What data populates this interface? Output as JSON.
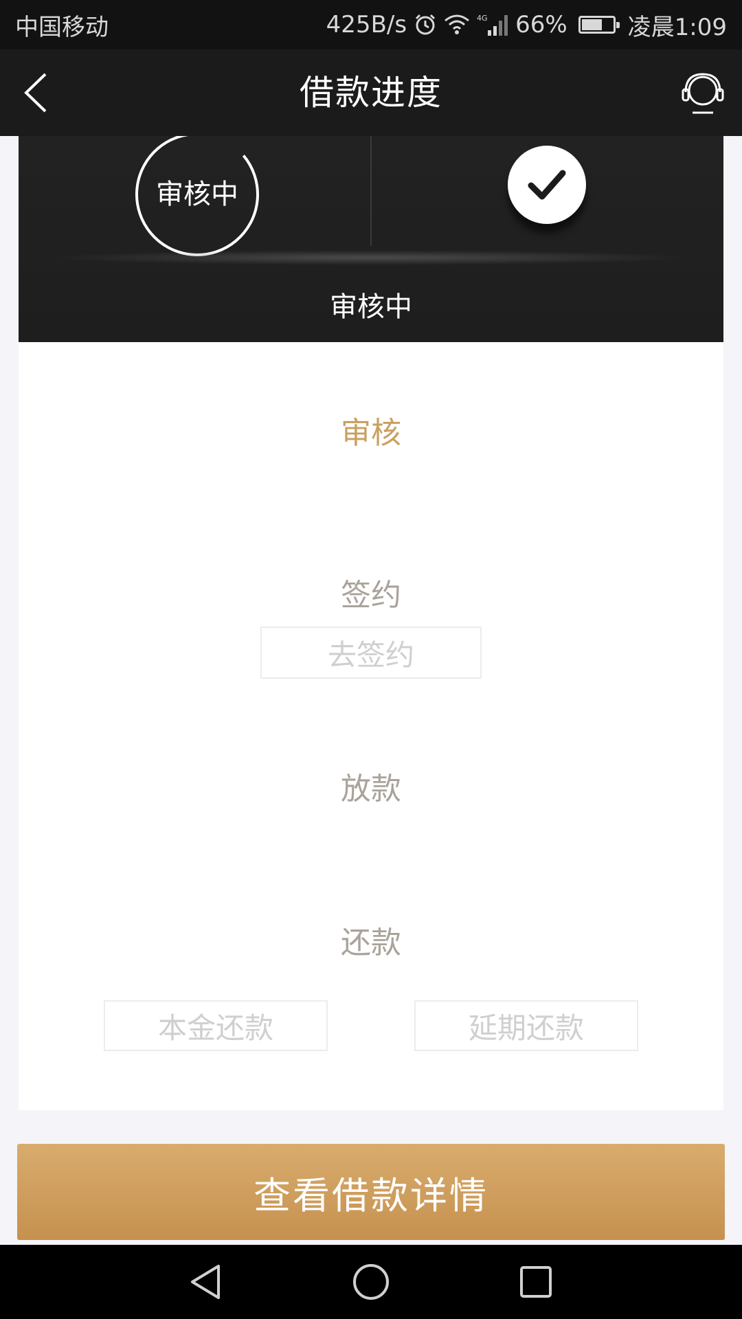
{
  "status_bar": {
    "carrier": "中国移动",
    "net_speed": "425B/s",
    "network": "4G",
    "battery": "66%",
    "battery_level": 0.66,
    "time": "凌晨1:09"
  },
  "header": {
    "title": "借款进度",
    "back_icon": "chevron-left-icon",
    "service_icon": "headset-icon"
  },
  "progress_card": {
    "current_step_label": "审核中",
    "status_text": "审核中",
    "completed_icon": "checkmark-icon"
  },
  "steps": {
    "review": {
      "label": "审核",
      "state": "active"
    },
    "sign": {
      "label": "签约",
      "action": "去签约"
    },
    "disburse": {
      "label": "放款"
    },
    "repay": {
      "label": "还款",
      "actions": [
        "本金还款",
        "延期还款"
      ]
    }
  },
  "colors": {
    "accent": "#c9a061",
    "button_top": "#d8ac6d",
    "button_bottom": "#c6914f",
    "header_bg": "#1b1b1b"
  },
  "main_button": {
    "label": "查看借款详情"
  },
  "nav_bar": {
    "back": "nav-back-icon",
    "home": "nav-home-icon",
    "recents": "nav-recents-icon"
  }
}
